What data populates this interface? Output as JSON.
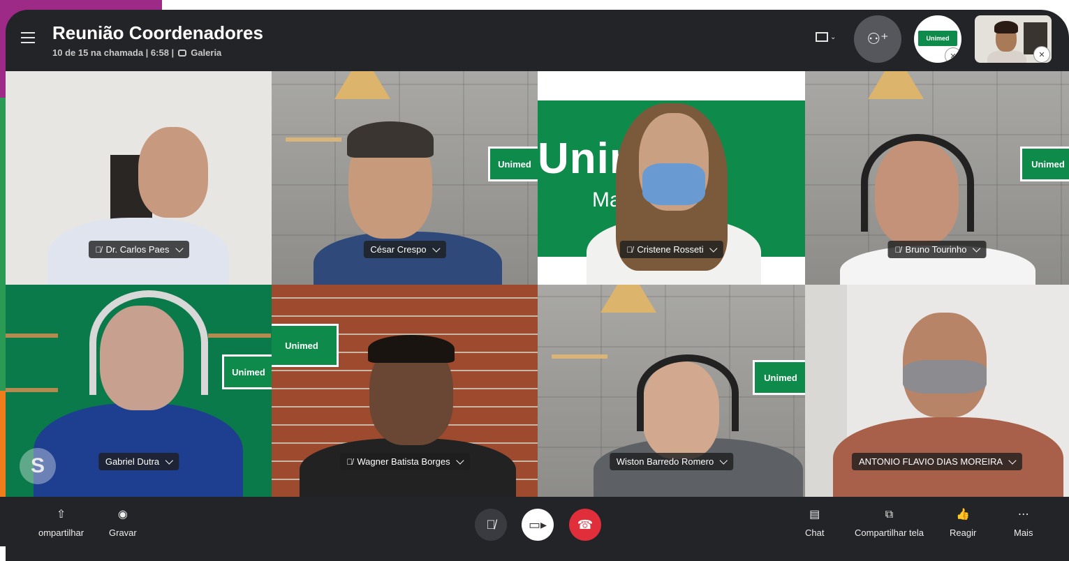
{
  "app": {
    "title": "Reunião Coordenadores",
    "call_status": "10 de 15 na chamada | 6:58 |",
    "view_mode": "Galeria"
  },
  "header_controls": {
    "layout_icon": "layout-icon",
    "add_participant_icon": "add-person-icon",
    "thumbnail_logo_text": "Unimed"
  },
  "participants": [
    {
      "name": "Dr. Carlos Paes",
      "muted": true
    },
    {
      "name": "César Crespo",
      "muted": false
    },
    {
      "name": "Cristene Rosseti",
      "muted": true
    },
    {
      "name": "Bruno Tourinho",
      "muted": true
    },
    {
      "name": "Gabriel Dutra",
      "muted": false
    },
    {
      "name": "Wagner Batista Borges",
      "muted": true
    },
    {
      "name": "Wiston Barredo Romero",
      "muted": false
    },
    {
      "name": "ANTONIO FLAVIO DIAS MOREIRA",
      "muted": false
    }
  ],
  "backgrounds": {
    "brand_text": "Unimed",
    "brand_sub": "Mato Grosso",
    "big_logo": "Unimed",
    "big_logo_sub": "Ma      o"
  },
  "toolbar": {
    "share_label": "ompartilhar",
    "record_label": "Gravar",
    "chat_label": "Chat",
    "share_screen_label": "Compartilhar tela",
    "react_label": "Reagir",
    "more_label": "Mais"
  },
  "colors": {
    "window_bg": "#232428",
    "brand_green": "#0e8a4a",
    "hangup_red": "#e02f3b",
    "deco_purple": "#9c2a86",
    "deco_green": "#2a9a54",
    "deco_orange": "#f07d1c"
  }
}
